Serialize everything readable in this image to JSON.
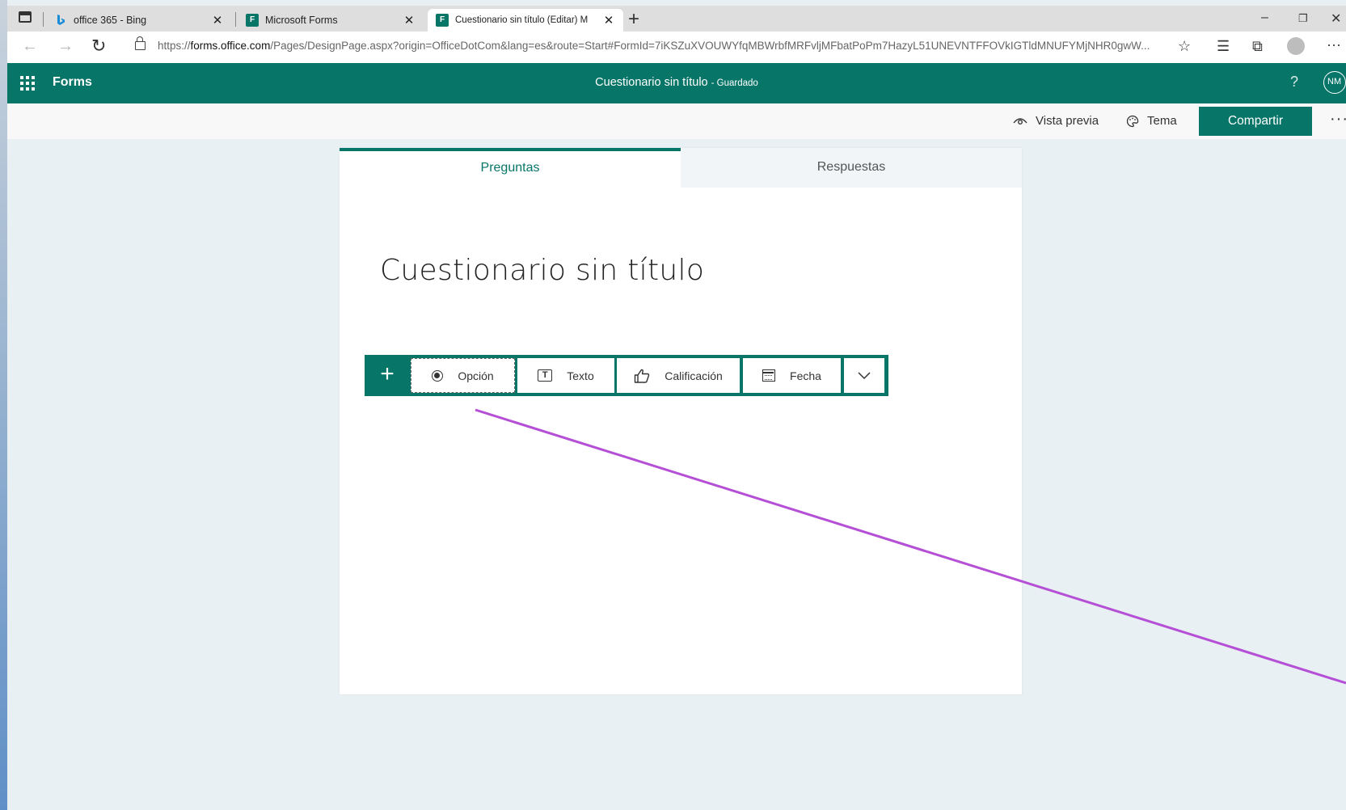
{
  "browser": {
    "tabs": [
      {
        "title": "office 365 - Bing",
        "icon": "bing-icon",
        "active": false
      },
      {
        "title": "Microsoft Forms",
        "icon": "forms-icon",
        "active": false
      },
      {
        "title": "Cuestionario sin título (Editar) M",
        "icon": "forms-icon",
        "active": true
      }
    ],
    "url_prefix": "https://",
    "url_host": "forms.office.com",
    "url_path": "/Pages/DesignPage.aspx?origin=OfficeDotCom&lang=es&route=Start#FormId=7iKSZuXVOUWYfqMBWrbfMRFvljMFbatPoPm7HazyL51UNEVNTFFOVkIGTldMNUFYMjNHR0gwW..."
  },
  "app": {
    "name": "Forms",
    "doc_title": "Cuestionario sin título",
    "save_status": "- Guardado",
    "help": "?",
    "avatar_initials": "NM",
    "brand_color": "#077568"
  },
  "commands": {
    "preview": "Vista previa",
    "theme": "Tema",
    "share": "Compartir",
    "more": "···"
  },
  "form": {
    "tabs": [
      {
        "label": "Preguntas",
        "active": true
      },
      {
        "label": "Respuestas",
        "active": false
      }
    ],
    "title": "Cuestionario sin título"
  },
  "question_types": {
    "add": "+",
    "items": [
      {
        "label": "Opción",
        "icon": "radio-icon"
      },
      {
        "label": "Texto",
        "icon": "text-icon"
      },
      {
        "label": "Calificación",
        "icon": "thumbs-up-icon"
      },
      {
        "label": "Fecha",
        "icon": "calendar-icon"
      }
    ],
    "expand": "chevron-down-icon"
  },
  "annotation": {
    "color": "#b44fd6"
  }
}
